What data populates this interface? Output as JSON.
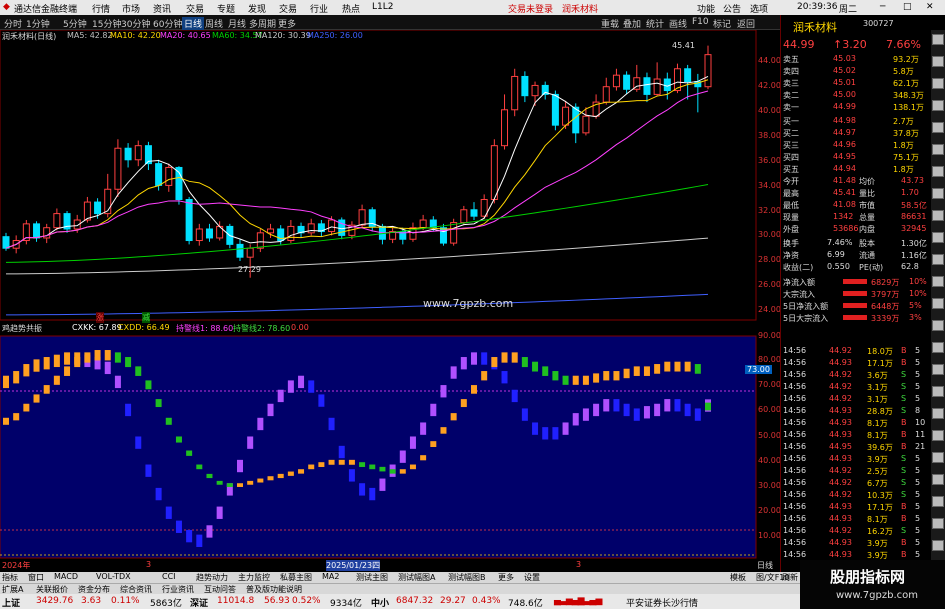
{
  "titlebar": {
    "app": "通达信金融终端",
    "menus": [
      "行情",
      "市场",
      "资讯",
      "交易",
      "专题",
      "发现",
      "交易",
      "行业",
      "热点",
      "L1L2"
    ],
    "notice": "交易未登录",
    "notice2": "润禾材料",
    "right": [
      "功能",
      "公告",
      "选项",
      "20:39:36",
      "周二"
    ]
  },
  "toolbar": {
    "periods": [
      "分时",
      "1分钟",
      "5分钟",
      "15分钟",
      "30分钟",
      "60分钟",
      "日线",
      "周线",
      "月线",
      "多周期",
      "更多"
    ],
    "right_btns": [
      "重载",
      "叠加",
      "统计",
      "画线",
      "F10",
      "标记",
      "返回"
    ]
  },
  "chart": {
    "title": "润禾材料(日线)",
    "ma": [
      {
        "label": "MA5: 42.82",
        "color": "#ffffff"
      },
      {
        "label": "MA10: 42.20",
        "color": "#ffd700"
      },
      {
        "label": "MA20: 40.65",
        "color": "#ff40ff"
      },
      {
        "label": "MA60: 34.57",
        "color": "#00d000"
      },
      {
        "label": "MA120: 30.39",
        "color": "#cccccc"
      },
      {
        "label": "MA250: 26.00",
        "color": "#3f5fff"
      }
    ],
    "price_axis": [
      "44.00",
      "42.00",
      "40.00",
      "38.00",
      "36.00",
      "34.00",
      "32.00",
      "30.00",
      "28.00",
      "26.00",
      "24.00"
    ],
    "high_label": "45.41",
    "low_label": "27.29",
    "watermark": "www.7gpzb.com",
    "marks": {
      "up": "涨",
      "down": "减"
    },
    "ind_title": "鸡趋势共振",
    "ind_vals": [
      {
        "label": "CXKK: 67.89",
        "color": "#ffffff"
      },
      {
        "label": "CXDD: 66.49",
        "color": "#ffd700"
      },
      {
        "label": "持警线1: 88.60",
        "color": "#ff40ff"
      },
      {
        "label": "持警线2: 78.60",
        "color": "#3fdc3f"
      },
      {
        "label": "0.00",
        "color": "#ff4040"
      }
    ],
    "ind_axis": [
      "90.00",
      "80.00",
      "70.00",
      "60.00",
      "50.00",
      "40.00",
      "30.00",
      "20.00",
      "10.00"
    ],
    "ind_tag": "73.00",
    "date_labels": [
      "2024年",
      "3",
      "2025/01/23四",
      "3"
    ],
    "day_btn": "日线"
  },
  "chart_data": {
    "type": "candlestick",
    "dates_shown": [
      "2024年",
      "2025/01/23"
    ],
    "ylim": [
      24,
      46
    ],
    "candles": [
      [
        30.5,
        29.6,
        30.8,
        29.4
      ],
      [
        29.6,
        30.2,
        30.6,
        29.2
      ],
      [
        30.2,
        31.5,
        31.8,
        29.9
      ],
      [
        31.5,
        30.4,
        31.7,
        30.1
      ],
      [
        30.4,
        31.2,
        31.5,
        30.0
      ],
      [
        31.2,
        32.3,
        32.7,
        31.0
      ],
      [
        32.3,
        31.1,
        32.5,
        30.8
      ],
      [
        31.1,
        31.8,
        32.2,
        30.8
      ],
      [
        31.8,
        33.2,
        33.6,
        31.6
      ],
      [
        33.2,
        32.3,
        33.5,
        31.9
      ],
      [
        32.3,
        34.2,
        35.4,
        32.0
      ],
      [
        34.2,
        37.4,
        38.1,
        33.6
      ],
      [
        37.4,
        36.5,
        37.8,
        35.9
      ],
      [
        36.5,
        37.6,
        38.0,
        36.0
      ],
      [
        37.6,
        36.2,
        37.9,
        35.7
      ],
      [
        36.2,
        34.5,
        36.5,
        34.1
      ],
      [
        34.5,
        35.9,
        36.2,
        34.0
      ],
      [
        35.9,
        33.4,
        36.0,
        33.0
      ],
      [
        33.4,
        30.2,
        33.6,
        29.9
      ],
      [
        30.2,
        31.1,
        31.5,
        29.8
      ],
      [
        31.1,
        30.4,
        31.5,
        30.1
      ],
      [
        30.4,
        31.3,
        31.7,
        30.2
      ],
      [
        31.3,
        29.9,
        31.5,
        29.6
      ],
      [
        29.9,
        28.9,
        30.3,
        28.6
      ],
      [
        28.9,
        29.6,
        29.9,
        27.3
      ],
      [
        29.6,
        30.8,
        31.1,
        29.3
      ],
      [
        30.8,
        31.1,
        31.5,
        30.4
      ],
      [
        31.1,
        30.2,
        31.4,
        29.9
      ],
      [
        30.2,
        31.3,
        31.8,
        30.0
      ],
      [
        31.3,
        30.8,
        31.6,
        30.4
      ],
      [
        30.8,
        31.5,
        31.9,
        30.6
      ],
      [
        31.5,
        30.9,
        31.8,
        30.5
      ],
      [
        30.9,
        31.8,
        32.1,
        30.6
      ],
      [
        31.8,
        30.6,
        32.0,
        30.3
      ],
      [
        30.6,
        31.4,
        31.7,
        30.3
      ],
      [
        31.4,
        32.6,
        33.0,
        31.2
      ],
      [
        32.6,
        31.3,
        32.8,
        30.9
      ],
      [
        31.3,
        30.3,
        31.5,
        29.9
      ],
      [
        30.3,
        30.9,
        31.2,
        30.0
      ],
      [
        30.9,
        30.3,
        31.2,
        29.9
      ],
      [
        30.3,
        31.2,
        31.6,
        30.1
      ],
      [
        31.2,
        31.8,
        32.2,
        31.0
      ],
      [
        31.8,
        31.2,
        32.1,
        30.9
      ],
      [
        31.2,
        30.0,
        31.5,
        29.8
      ],
      [
        30.0,
        31.6,
        31.9,
        29.8
      ],
      [
        31.6,
        32.6,
        32.9,
        31.4
      ],
      [
        32.6,
        32.1,
        33.2,
        31.8
      ],
      [
        32.1,
        33.4,
        33.8,
        31.9
      ],
      [
        33.4,
        37.6,
        38.1,
        33.1
      ],
      [
        37.6,
        40.4,
        41.6,
        37.3
      ],
      [
        40.4,
        43.0,
        43.6,
        39.9
      ],
      [
        43.0,
        41.5,
        43.4,
        41.0
      ],
      [
        41.5,
        42.3,
        42.6,
        40.7
      ],
      [
        42.3,
        41.6,
        42.6,
        41.2
      ],
      [
        41.6,
        39.2,
        41.9,
        38.8
      ],
      [
        39.2,
        40.6,
        41.1,
        38.9
      ],
      [
        40.6,
        38.6,
        40.9,
        37.8
      ],
      [
        38.6,
        39.9,
        40.6,
        38.4
      ],
      [
        39.9,
        41.0,
        41.6,
        39.7
      ],
      [
        41.0,
        42.2,
        42.9,
        40.8
      ],
      [
        42.2,
        43.1,
        43.6,
        41.9
      ],
      [
        43.1,
        42.0,
        43.4,
        41.6
      ],
      [
        42.0,
        42.9,
        43.9,
        41.8
      ],
      [
        42.9,
        41.6,
        43.3,
        41.0
      ],
      [
        41.6,
        42.8,
        44.1,
        41.5
      ],
      [
        42.8,
        41.9,
        43.3,
        41.2
      ],
      [
        41.9,
        43.6,
        44.0,
        41.7
      ],
      [
        43.6,
        42.6,
        43.9,
        41.2
      ],
      [
        42.6,
        42.2,
        43.2,
        40.2
      ],
      [
        42.2,
        44.7,
        45.41,
        42.0
      ]
    ],
    "series": [
      {
        "name": "MA5",
        "values": [
          42.82
        ]
      },
      {
        "name": "MA10",
        "values": [
          42.2
        ]
      },
      {
        "name": "MA20",
        "values": [
          40.65
        ]
      },
      {
        "name": "MA60",
        "values": [
          34.57
        ]
      },
      {
        "name": "MA120",
        "values": [
          30.39
        ]
      },
      {
        "name": "MA250",
        "values": [
          26.0
        ]
      }
    ],
    "indicator": {
      "name": "鸡趋势共振",
      "CXKK": 67.89,
      "CXDD": 66.49,
      "持警线1": 88.6,
      "持警线2": 78.6,
      "ylim": [
        0,
        95
      ]
    }
  },
  "quote": {
    "name": "润禾材料",
    "code": "300727",
    "price": "44.99",
    "change": "↑3.20",
    "pct": "7.66%",
    "asks": [
      {
        "l": "卖五",
        "p": "45.03",
        "v": "93.2万"
      },
      {
        "l": "卖四",
        "p": "45.02",
        "v": "5.8万"
      },
      {
        "l": "卖三",
        "p": "45.01",
        "v": "62.1万"
      },
      {
        "l": "卖二",
        "p": "45.00",
        "v": "348.3万"
      },
      {
        "l": "卖一",
        "p": "44.99",
        "v": "138.1万"
      }
    ],
    "bids": [
      {
        "l": "买一",
        "p": "44.98",
        "v": "2.7万"
      },
      {
        "l": "买二",
        "p": "44.97",
        "v": "37.8万"
      },
      {
        "l": "买三",
        "p": "44.96",
        "v": "1.8万"
      },
      {
        "l": "买四",
        "p": "44.95",
        "v": "75.1万"
      },
      {
        "l": "买五",
        "p": "44.94",
        "v": "1.8万"
      }
    ],
    "stats": [
      {
        "a": "今开",
        "b": "41.48",
        "c": "均价",
        "d": "43.73"
      },
      {
        "a": "最高",
        "b": "45.41",
        "c": "量比",
        "d": "1.70"
      },
      {
        "a": "最低",
        "b": "41.08",
        "c": "市值",
        "d": "58.5亿"
      },
      {
        "a": "现量",
        "b": "1342",
        "c": "总量",
        "d": "86631"
      },
      {
        "a": "外盘",
        "b": "53686",
        "c": "内盘",
        "d": "32945"
      }
    ],
    "stats2": [
      {
        "a": "换手",
        "b": "7.46%",
        "c": "股本",
        "d": "1.30亿"
      },
      {
        "a": "净资",
        "b": "6.99",
        "c": "流通",
        "d": "1.16亿"
      },
      {
        "a": "收益(二)",
        "b": "0.550",
        "c": "PE(动)",
        "d": "62.8"
      }
    ],
    "flows": [
      {
        "l": "净流入额",
        "v": "6829万",
        "p": "10%"
      },
      {
        "l": "大宗流入",
        "v": "3797万",
        "p": "10%"
      },
      {
        "l": "5日净流入额",
        "v": "6448万",
        "p": "5%"
      },
      {
        "l": "5日大宗流入",
        "v": "3339万",
        "p": "3%"
      }
    ],
    "ticks": [
      [
        "14:56",
        "44.92",
        "18.0万",
        "B",
        "5"
      ],
      [
        "14:56",
        "44.93",
        "17.1万",
        "B",
        "5"
      ],
      [
        "14:56",
        "44.92",
        "3.6万",
        "S",
        "5"
      ],
      [
        "14:56",
        "44.92",
        "3.1万",
        "S",
        "5"
      ],
      [
        "14:56",
        "44.92",
        "3.1万",
        "S",
        "5"
      ],
      [
        "14:56",
        "44.93",
        "28.8万",
        "S",
        "8"
      ],
      [
        "14:56",
        "44.93",
        "8.1万",
        "B",
        "10"
      ],
      [
        "14:56",
        "44.93",
        "8.1万",
        "B",
        "11"
      ],
      [
        "14:56",
        "44.95",
        "39.6万",
        "B",
        "21"
      ],
      [
        "14:56",
        "44.93",
        "3.9万",
        "S",
        "5"
      ],
      [
        "14:56",
        "44.92",
        "2.5万",
        "S",
        "5"
      ],
      [
        "14:56",
        "44.92",
        "6.7万",
        "S",
        "5"
      ],
      [
        "14:56",
        "44.92",
        "10.3万",
        "S",
        "5"
      ],
      [
        "14:56",
        "44.93",
        "17.1万",
        "B",
        "5"
      ],
      [
        "14:56",
        "44.93",
        "8.1万",
        "B",
        "5"
      ],
      [
        "14:56",
        "44.92",
        "16.2万",
        "S",
        "5"
      ],
      [
        "14:56",
        "44.93",
        "3.9万",
        "B",
        "5"
      ],
      [
        "14:56",
        "44.93",
        "3.9万",
        "B",
        "5"
      ]
    ]
  },
  "bottombar": [
    "指标",
    "窗口",
    "MACD",
    "VOL-TDX",
    "CCI",
    "趋势动力",
    "主力监控",
    "私募主图",
    "MA2",
    "测试主图",
    "测试幅图A",
    "测试幅图B",
    "更多",
    "设置"
  ],
  "bottombar2": [
    "扩展A",
    "关联报价",
    "资金分布",
    "综合资讯",
    "行业资讯",
    "互动问答",
    "普及版功能说明"
  ],
  "right_tabs": [
    "模板",
    "图/文F10",
    "刷新"
  ],
  "status": {
    "sh_label": "上证",
    "sh_val": "3429.76",
    "sh_chg": "3.63",
    "sh_pct": "0.11%",
    "sh_amt": "5863亿",
    "sz_label": "深证",
    "sz_val": "11014.8",
    "sz_chg": "56.93",
    "sz_pct": "0.52%",
    "sz_amt": "9334亿",
    "zx_label": "中小",
    "zx_val": "6847.32",
    "zx_chg": "29.27",
    "zx_pct": "0.43%",
    "zx_amt": "748.6亿",
    "broker": "平安证券长沙行情"
  },
  "brand": "股朋指标网",
  "colors": {
    "up": "#ff4040",
    "down": "#3fdc3f",
    "ind_bg": "#00006a",
    "border": "#800000"
  }
}
